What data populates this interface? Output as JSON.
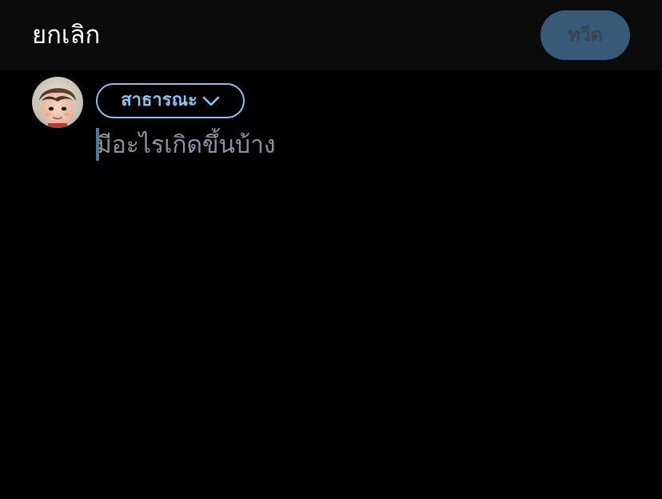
{
  "header": {
    "cancel_label": "ยกเลิก",
    "tweet_label": "ทวีต",
    "tweet_enabled": false
  },
  "composer": {
    "audience_label": "สาธารณะ",
    "placeholder": "มีอะไรเกิดขึ้นบ้าง",
    "text": ""
  },
  "icons": {
    "audience_dropdown": "chevron-down-icon",
    "avatar": "profile-avatar"
  },
  "colors": {
    "background": "#000000",
    "header_background": "#0b0b0b",
    "accent": "#8fc1ec",
    "tweet_button_disabled_bg": "#365a77",
    "tweet_button_disabled_text": "#36454f",
    "caret": "#4f77a0",
    "placeholder_text": "#8b949e",
    "text": "#ffffff"
  }
}
